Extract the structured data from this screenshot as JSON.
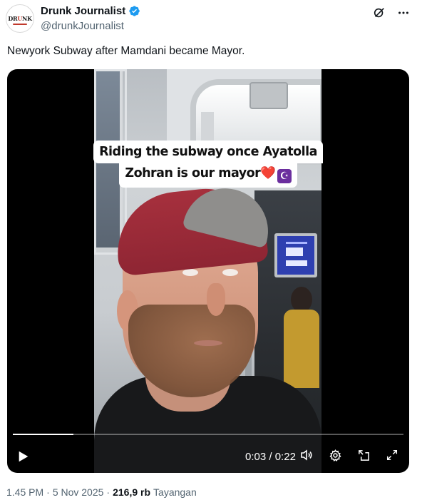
{
  "author": {
    "display_name": "Drunk Journalist",
    "handle": "@drunkJournalist",
    "avatar_text_left": "DR",
    "avatar_text_mid": "U",
    "avatar_text_right": "NK",
    "verified": true,
    "verified_color": "#1d9bf0"
  },
  "header_actions": {
    "grok_icon": "grok-icon",
    "more_icon": "more-icon"
  },
  "tweet": {
    "text": "Newyork Subway after Mamdani became Mayor."
  },
  "video": {
    "caption_line1": "Riding the subway once Ayatolla",
    "caption_line2": "Zohran is our mayor",
    "caption_emoji_heart": "❤️",
    "caption_emoji_crescent": "☪",
    "current_time": "0:03",
    "separator": " / ",
    "duration": "0:22",
    "progress_fraction": 0.155
  },
  "meta": {
    "time": "1.45 PM",
    "dot1": "·",
    "date": "5 Nov 2025",
    "dot2": "·",
    "views": "216,9 rb",
    "views_label": "Tayangan"
  }
}
